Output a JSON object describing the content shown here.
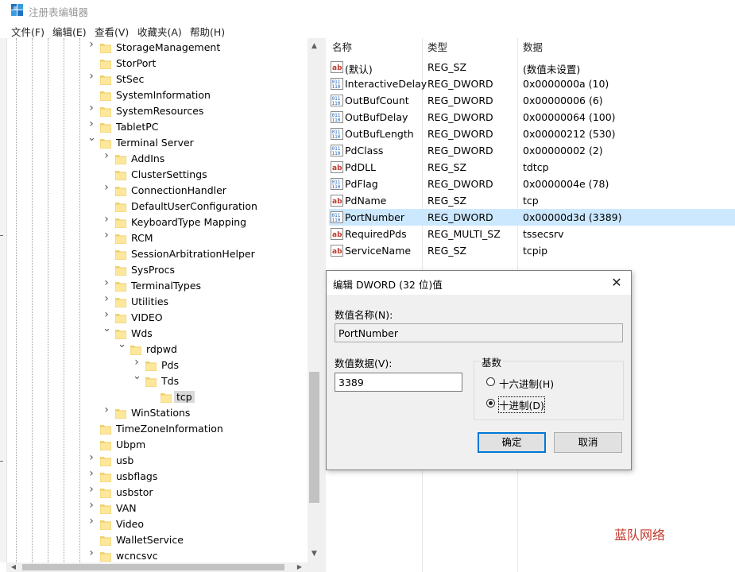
{
  "window": {
    "title": "注册表编辑器"
  },
  "menu": [
    "文件(F)",
    "编辑(E)",
    "查看(V)",
    "收藏夹(A)",
    "帮助(H)"
  ],
  "tree": [
    {
      "label": "StorageManagement",
      "level": 0,
      "expander": "collapsed"
    },
    {
      "label": "StorPort",
      "level": 0,
      "expander": "none"
    },
    {
      "label": "StSec",
      "level": 0,
      "expander": "collapsed"
    },
    {
      "label": "SystemInformation",
      "level": 0,
      "expander": "none"
    },
    {
      "label": "SystemResources",
      "level": 0,
      "expander": "collapsed"
    },
    {
      "label": "TabletPC",
      "level": 0,
      "expander": "collapsed"
    },
    {
      "label": "Terminal Server",
      "level": 0,
      "expander": "expanded"
    },
    {
      "label": "AddIns",
      "level": 1,
      "expander": "collapsed"
    },
    {
      "label": "ClusterSettings",
      "level": 1,
      "expander": "none"
    },
    {
      "label": "ConnectionHandler",
      "level": 1,
      "expander": "collapsed"
    },
    {
      "label": "DefaultUserConfiguration",
      "level": 1,
      "expander": "none"
    },
    {
      "label": "KeyboardType Mapping",
      "level": 1,
      "expander": "collapsed"
    },
    {
      "label": "RCM",
      "level": 1,
      "expander": "collapsed"
    },
    {
      "label": "SessionArbitrationHelper",
      "level": 1,
      "expander": "none"
    },
    {
      "label": "SysProcs",
      "level": 1,
      "expander": "none"
    },
    {
      "label": "TerminalTypes",
      "level": 1,
      "expander": "collapsed"
    },
    {
      "label": "Utilities",
      "level": 1,
      "expander": "collapsed"
    },
    {
      "label": "VIDEO",
      "level": 1,
      "expander": "collapsed"
    },
    {
      "label": "Wds",
      "level": 1,
      "expander": "expanded"
    },
    {
      "label": "rdpwd",
      "level": 2,
      "expander": "expanded"
    },
    {
      "label": "Pds",
      "level": 3,
      "expander": "collapsed"
    },
    {
      "label": "Tds",
      "level": 3,
      "expander": "expanded"
    },
    {
      "label": "tcp",
      "level": 4,
      "expander": "none",
      "selected": true
    },
    {
      "label": "WinStations",
      "level": 1,
      "expander": "collapsed"
    },
    {
      "label": "TimeZoneInformation",
      "level": 0,
      "expander": "none"
    },
    {
      "label": "Ubpm",
      "level": 0,
      "expander": "none"
    },
    {
      "label": "usb",
      "level": 0,
      "expander": "collapsed"
    },
    {
      "label": "usbflags",
      "level": 0,
      "expander": "collapsed"
    },
    {
      "label": "usbstor",
      "level": 0,
      "expander": "collapsed"
    },
    {
      "label": "VAN",
      "level": 0,
      "expander": "collapsed"
    },
    {
      "label": "Video",
      "level": 0,
      "expander": "collapsed"
    },
    {
      "label": "WalletService",
      "level": 0,
      "expander": "none"
    },
    {
      "label": "wcncsvc",
      "level": 0,
      "expander": "collapsed"
    }
  ],
  "list": {
    "columns": [
      "名称",
      "类型",
      "数据"
    ],
    "rows": [
      {
        "name": "(默认)",
        "type": "REG_SZ",
        "data": "(数值未设置)",
        "icon": "string-value-icon"
      },
      {
        "name": "InteractiveDelay",
        "type": "REG_DWORD",
        "data": "0x0000000a (10)",
        "icon": "binary-value-icon"
      },
      {
        "name": "OutBufCount",
        "type": "REG_DWORD",
        "data": "0x00000006 (6)",
        "icon": "binary-value-icon"
      },
      {
        "name": "OutBufDelay",
        "type": "REG_DWORD",
        "data": "0x00000064 (100)",
        "icon": "binary-value-icon"
      },
      {
        "name": "OutBufLength",
        "type": "REG_DWORD",
        "data": "0x00000212 (530)",
        "icon": "binary-value-icon"
      },
      {
        "name": "PdClass",
        "type": "REG_DWORD",
        "data": "0x00000002 (2)",
        "icon": "binary-value-icon"
      },
      {
        "name": "PdDLL",
        "type": "REG_SZ",
        "data": "tdtcp",
        "icon": "string-value-icon"
      },
      {
        "name": "PdFlag",
        "type": "REG_DWORD",
        "data": "0x0000004e (78)",
        "icon": "binary-value-icon"
      },
      {
        "name": "PdName",
        "type": "REG_SZ",
        "data": "tcp",
        "icon": "string-value-icon"
      },
      {
        "name": "PortNumber",
        "type": "REG_DWORD",
        "data": "0x00000d3d (3389)",
        "icon": "binary-value-icon",
        "selected": true
      },
      {
        "name": "RequiredPds",
        "type": "REG_MULTI_SZ",
        "data": "tssecsrv",
        "icon": "string-value-icon"
      },
      {
        "name": "ServiceName",
        "type": "REG_SZ",
        "data": "tcpip",
        "icon": "string-value-icon"
      }
    ]
  },
  "dialog": {
    "title": "编辑 DWORD (32 位)值",
    "close": "✕",
    "name_label": "数值名称(N):",
    "name_value": "PortNumber",
    "data_label": "数值数据(V):",
    "data_value": "3389",
    "base_label": "基数",
    "radio_hex": "十六进制(H)",
    "radio_dec": "十进制(D)",
    "selected_base": "dec",
    "ok": "确定",
    "cancel": "取消"
  },
  "watermark": "蓝队网络",
  "colors": {
    "selection": "#cce8ff",
    "accent": "#0078d7",
    "watermark": "#c0392b"
  }
}
